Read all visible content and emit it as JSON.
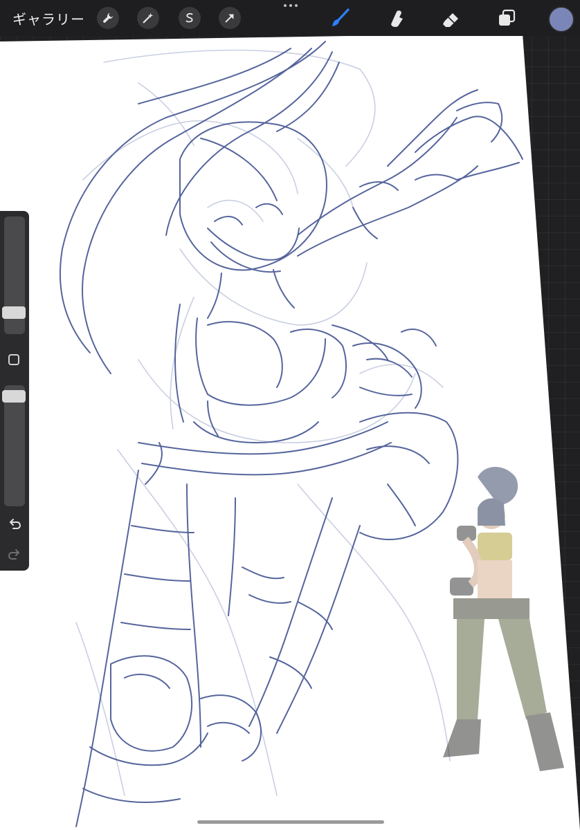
{
  "app": {
    "gallery_label": "ギャラリー",
    "top_tools": [
      "wrench-icon",
      "magic-wand-icon",
      "selection-icon",
      "transform-arrow-icon"
    ],
    "right_tools": [
      "brush-icon",
      "smudge-icon",
      "eraser-icon",
      "layers-icon"
    ],
    "active_tool": "brush-icon",
    "accent_color": "#2f80ff",
    "current_color": "#7b86b8"
  },
  "sidebar": {
    "brush_size_level": 0.2,
    "opacity_level": 0.95,
    "buttons": [
      "modify-square-icon",
      "undo-icon",
      "redo-icon"
    ]
  },
  "canvas": {
    "content": "sketch-artwork",
    "sketch_color": "#4c5c97",
    "reference_image": "reference-character-image"
  }
}
